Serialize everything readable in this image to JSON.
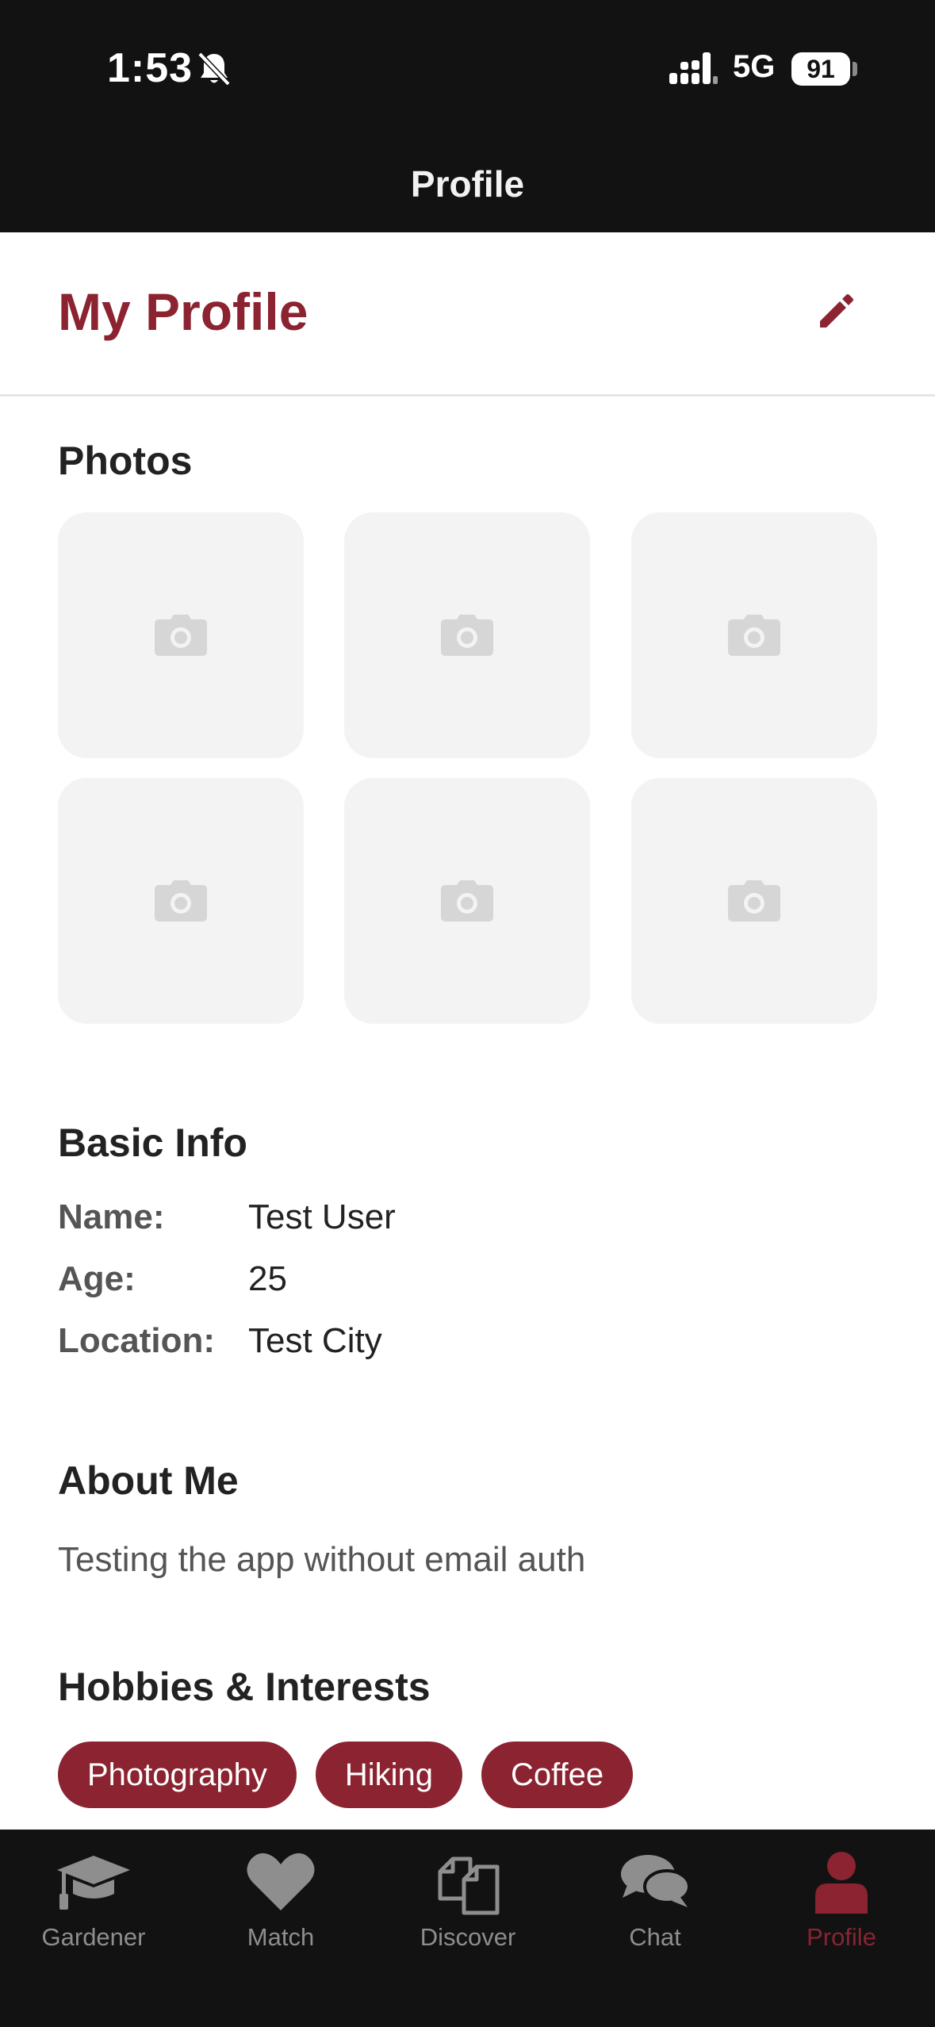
{
  "status_bar": {
    "time": "1:53",
    "network": "5G",
    "battery": "91"
  },
  "nav": {
    "title": "Profile"
  },
  "header": {
    "title": "My Profile"
  },
  "photos": {
    "title": "Photos",
    "slots": 6
  },
  "basic_info": {
    "title": "Basic Info",
    "rows": [
      {
        "label": "Name:",
        "value": "Test User"
      },
      {
        "label": "Age:",
        "value": "25"
      },
      {
        "label": "Location:",
        "value": "Test City"
      }
    ]
  },
  "about": {
    "title": "About Me",
    "text": "Testing the app without email auth"
  },
  "hobbies": {
    "title": "Hobbies & Interests",
    "chips": [
      "Photography",
      "Hiking",
      "Coffee"
    ]
  },
  "tabbar": {
    "tabs": [
      {
        "label": "Gardener",
        "icon": "graduation-cap-icon"
      },
      {
        "label": "Match",
        "icon": "heart-icon"
      },
      {
        "label": "Discover",
        "icon": "documents-icon"
      },
      {
        "label": "Chat",
        "icon": "chat-bubbles-icon"
      },
      {
        "label": "Profile",
        "icon": "person-icon"
      }
    ],
    "active": "Profile"
  },
  "colors": {
    "accent": "#8b2331",
    "bar_bg": "#121212",
    "tile_bg": "#f3f3f3",
    "inactive_tab": "#8e8e8e"
  }
}
